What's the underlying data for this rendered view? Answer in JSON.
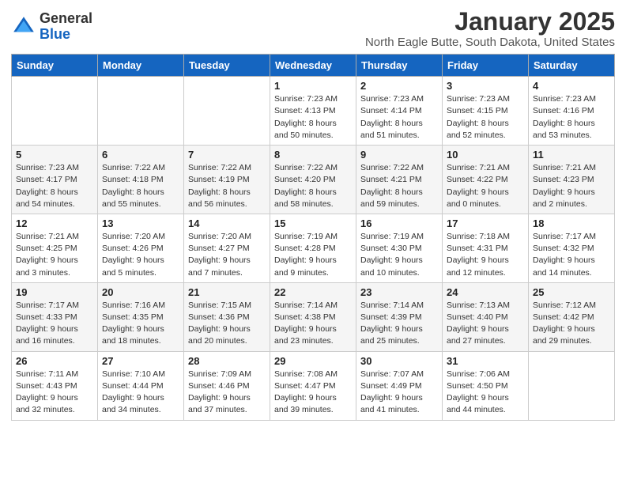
{
  "logo": {
    "general": "General",
    "blue": "Blue"
  },
  "title": "January 2025",
  "location": "North Eagle Butte, South Dakota, United States",
  "days_of_week": [
    "Sunday",
    "Monday",
    "Tuesday",
    "Wednesday",
    "Thursday",
    "Friday",
    "Saturday"
  ],
  "weeks": [
    [
      {
        "day": "",
        "info": ""
      },
      {
        "day": "",
        "info": ""
      },
      {
        "day": "",
        "info": ""
      },
      {
        "day": "1",
        "info": "Sunrise: 7:23 AM\nSunset: 4:13 PM\nDaylight: 8 hours\nand 50 minutes."
      },
      {
        "day": "2",
        "info": "Sunrise: 7:23 AM\nSunset: 4:14 PM\nDaylight: 8 hours\nand 51 minutes."
      },
      {
        "day": "3",
        "info": "Sunrise: 7:23 AM\nSunset: 4:15 PM\nDaylight: 8 hours\nand 52 minutes."
      },
      {
        "day": "4",
        "info": "Sunrise: 7:23 AM\nSunset: 4:16 PM\nDaylight: 8 hours\nand 53 minutes."
      }
    ],
    [
      {
        "day": "5",
        "info": "Sunrise: 7:23 AM\nSunset: 4:17 PM\nDaylight: 8 hours\nand 54 minutes."
      },
      {
        "day": "6",
        "info": "Sunrise: 7:22 AM\nSunset: 4:18 PM\nDaylight: 8 hours\nand 55 minutes."
      },
      {
        "day": "7",
        "info": "Sunrise: 7:22 AM\nSunset: 4:19 PM\nDaylight: 8 hours\nand 56 minutes."
      },
      {
        "day": "8",
        "info": "Sunrise: 7:22 AM\nSunset: 4:20 PM\nDaylight: 8 hours\nand 58 minutes."
      },
      {
        "day": "9",
        "info": "Sunrise: 7:22 AM\nSunset: 4:21 PM\nDaylight: 8 hours\nand 59 minutes."
      },
      {
        "day": "10",
        "info": "Sunrise: 7:21 AM\nSunset: 4:22 PM\nDaylight: 9 hours\nand 0 minutes."
      },
      {
        "day": "11",
        "info": "Sunrise: 7:21 AM\nSunset: 4:23 PM\nDaylight: 9 hours\nand 2 minutes."
      }
    ],
    [
      {
        "day": "12",
        "info": "Sunrise: 7:21 AM\nSunset: 4:25 PM\nDaylight: 9 hours\nand 3 minutes."
      },
      {
        "day": "13",
        "info": "Sunrise: 7:20 AM\nSunset: 4:26 PM\nDaylight: 9 hours\nand 5 minutes."
      },
      {
        "day": "14",
        "info": "Sunrise: 7:20 AM\nSunset: 4:27 PM\nDaylight: 9 hours\nand 7 minutes."
      },
      {
        "day": "15",
        "info": "Sunrise: 7:19 AM\nSunset: 4:28 PM\nDaylight: 9 hours\nand 9 minutes."
      },
      {
        "day": "16",
        "info": "Sunrise: 7:19 AM\nSunset: 4:30 PM\nDaylight: 9 hours\nand 10 minutes."
      },
      {
        "day": "17",
        "info": "Sunrise: 7:18 AM\nSunset: 4:31 PM\nDaylight: 9 hours\nand 12 minutes."
      },
      {
        "day": "18",
        "info": "Sunrise: 7:17 AM\nSunset: 4:32 PM\nDaylight: 9 hours\nand 14 minutes."
      }
    ],
    [
      {
        "day": "19",
        "info": "Sunrise: 7:17 AM\nSunset: 4:33 PM\nDaylight: 9 hours\nand 16 minutes."
      },
      {
        "day": "20",
        "info": "Sunrise: 7:16 AM\nSunset: 4:35 PM\nDaylight: 9 hours\nand 18 minutes."
      },
      {
        "day": "21",
        "info": "Sunrise: 7:15 AM\nSunset: 4:36 PM\nDaylight: 9 hours\nand 20 minutes."
      },
      {
        "day": "22",
        "info": "Sunrise: 7:14 AM\nSunset: 4:38 PM\nDaylight: 9 hours\nand 23 minutes."
      },
      {
        "day": "23",
        "info": "Sunrise: 7:14 AM\nSunset: 4:39 PM\nDaylight: 9 hours\nand 25 minutes."
      },
      {
        "day": "24",
        "info": "Sunrise: 7:13 AM\nSunset: 4:40 PM\nDaylight: 9 hours\nand 27 minutes."
      },
      {
        "day": "25",
        "info": "Sunrise: 7:12 AM\nSunset: 4:42 PM\nDaylight: 9 hours\nand 29 minutes."
      }
    ],
    [
      {
        "day": "26",
        "info": "Sunrise: 7:11 AM\nSunset: 4:43 PM\nDaylight: 9 hours\nand 32 minutes."
      },
      {
        "day": "27",
        "info": "Sunrise: 7:10 AM\nSunset: 4:44 PM\nDaylight: 9 hours\nand 34 minutes."
      },
      {
        "day": "28",
        "info": "Sunrise: 7:09 AM\nSunset: 4:46 PM\nDaylight: 9 hours\nand 37 minutes."
      },
      {
        "day": "29",
        "info": "Sunrise: 7:08 AM\nSunset: 4:47 PM\nDaylight: 9 hours\nand 39 minutes."
      },
      {
        "day": "30",
        "info": "Sunrise: 7:07 AM\nSunset: 4:49 PM\nDaylight: 9 hours\nand 41 minutes."
      },
      {
        "day": "31",
        "info": "Sunrise: 7:06 AM\nSunset: 4:50 PM\nDaylight: 9 hours\nand 44 minutes."
      },
      {
        "day": "",
        "info": ""
      }
    ]
  ]
}
